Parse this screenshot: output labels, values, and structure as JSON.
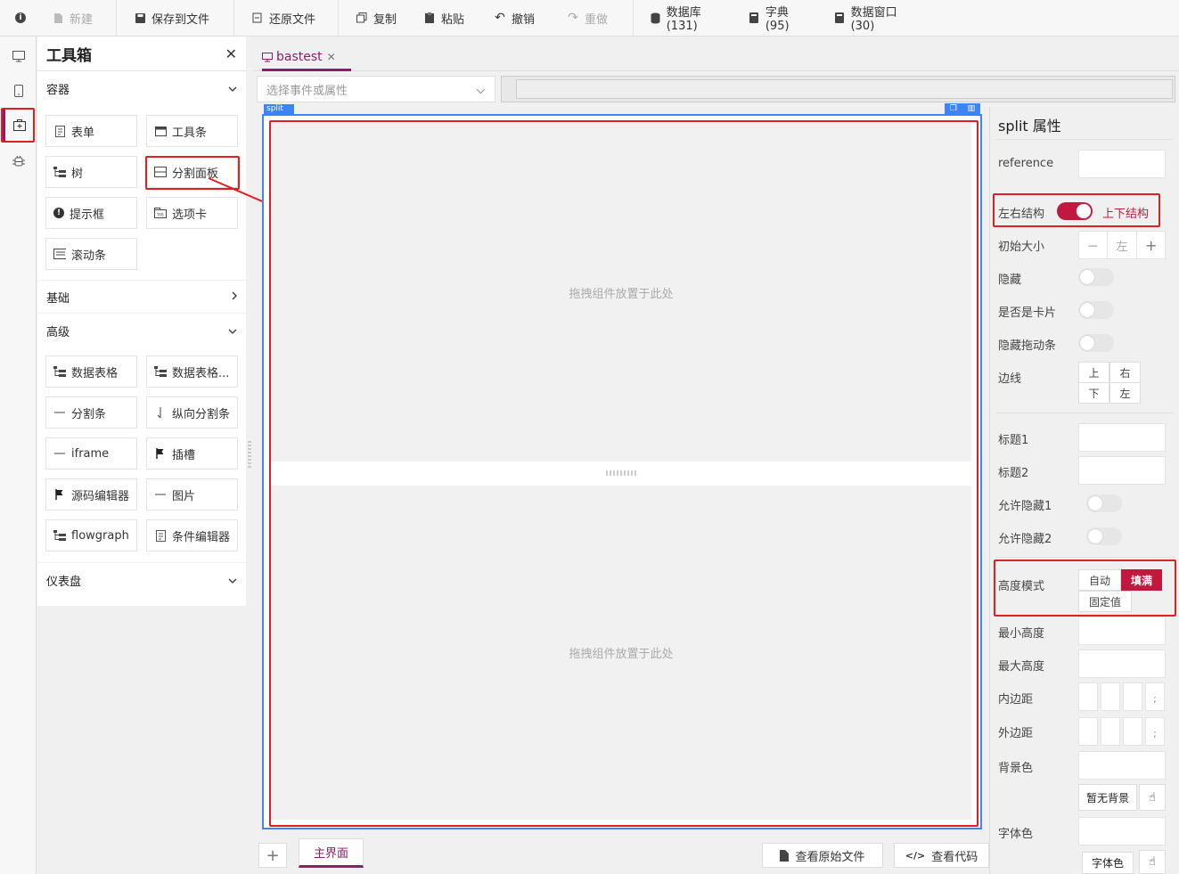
{
  "toolbar": {
    "info_icon": "info-icon",
    "items": [
      {
        "label": "新建",
        "icon": "file-icon",
        "disabled": true
      },
      {
        "label": "保存到文件",
        "icon": "save-icon",
        "disabled": false
      },
      {
        "label": "还原文件",
        "icon": "restore-icon",
        "disabled": false
      },
      {
        "label": "复制",
        "icon": "copy-icon",
        "disabled": false
      },
      {
        "label": "粘贴",
        "icon": "paste-icon",
        "disabled": false
      },
      {
        "label": "撤销",
        "icon": "undo-icon",
        "disabled": false
      },
      {
        "label": "重做",
        "icon": "redo-icon",
        "disabled": true
      },
      {
        "label": "数据库(131)",
        "icon": "database-icon",
        "disabled": false
      },
      {
        "label": "字典(95)",
        "icon": "book-icon",
        "disabled": false
      },
      {
        "label": "数据窗口(30)",
        "icon": "book-icon",
        "disabled": false
      }
    ]
  },
  "toolbox": {
    "title": "工具箱",
    "sections": {
      "container": {
        "label": "容器",
        "items": [
          "表单",
          "工具条",
          "树",
          "分割面板",
          "提示框",
          "选项卡",
          "滚动条"
        ]
      },
      "basic": {
        "label": "基础"
      },
      "advanced": {
        "label": "高级",
        "items": [
          "数据表格",
          "数据表格...",
          "分割条",
          "纵向分割条",
          "iframe",
          "插槽",
          "源码编辑器",
          "图片",
          "flowgraph",
          "条件编辑器"
        ]
      },
      "dashboard": {
        "label": "仪表盘"
      }
    }
  },
  "tabs": {
    "active": "bastest"
  },
  "event_bar": {
    "placeholder": "选择事件或属性"
  },
  "canvas": {
    "label": "split",
    "top_pane_text": "拖拽组件放置于此处",
    "bottom_pane_text": "拖拽组件放置于此处"
  },
  "bottom": {
    "add": "+",
    "page_tab": "主界面",
    "view_source": "查看原始文件",
    "view_code": "查看代码"
  },
  "props": {
    "title": "split 属性",
    "reference": "reference",
    "layout_left": "左右结构",
    "layout_right": "上下结构",
    "layout_on": true,
    "initial_size": "初始大小",
    "initial_size_minus": "—",
    "initial_size_value": "左",
    "initial_size_plus": "+",
    "hidden": "隐藏",
    "is_card": "是否是卡片",
    "hide_drag": "隐藏拖动条",
    "border": "边线",
    "border_top": "上",
    "border_right": "右",
    "border_bottom": "下",
    "border_left": "左",
    "title1": "标题1",
    "title2": "标题2",
    "allow_hide1": "允许隐藏1",
    "allow_hide2": "允许隐藏2",
    "height_mode": "高度模式",
    "height_auto": "自动",
    "height_fill": "填满",
    "height_fixed": "固定值",
    "min_height": "最小高度",
    "max_height": "最大高度",
    "padding": "内边距",
    "margin": "外边距",
    "semicolon": ";",
    "bg_color": "背景色",
    "no_bg": "暂无背景",
    "font_color": "字体色",
    "font_color_btn": "字体色"
  },
  "colors": {
    "accent": "#8b1d6b",
    "toggle_on": "#c2183e",
    "highlight": "#e02020",
    "canvas_border": "#3d85f7"
  }
}
